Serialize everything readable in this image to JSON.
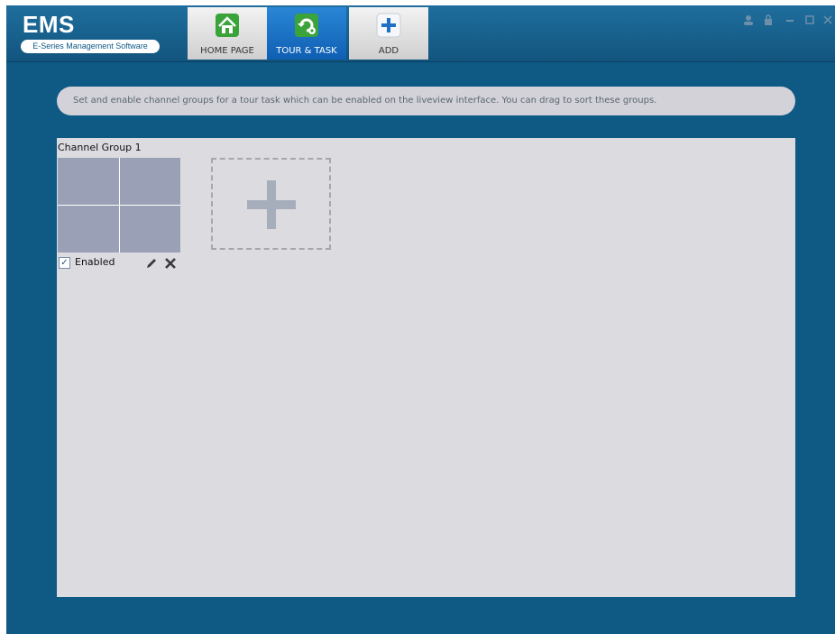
{
  "app": {
    "title": "EMS",
    "subtitle": "E-Series Management Software"
  },
  "tabs": [
    {
      "label": "HOME PAGE",
      "icon": "home-icon",
      "active": false
    },
    {
      "label": "TOUR & TASK",
      "icon": "tour-task-icon",
      "active": true
    },
    {
      "label": "ADD",
      "icon": "add-icon",
      "active": false
    }
  ],
  "window_controls": [
    "user-icon",
    "lock-icon",
    "minimize-icon",
    "maximize-icon",
    "close-icon"
  ],
  "banner": {
    "text": "Set and enable channel groups for a tour task which can be enabled on the liveview interface. You can drag to sort these groups."
  },
  "groups": [
    {
      "title": "Channel Group 1",
      "enabled": true,
      "enabled_label": "Enabled",
      "layout": "2x2"
    }
  ],
  "colors": {
    "window_bg": "#0f5a85",
    "tab_active": "#1a73c8",
    "panel_bg": "#dcdce0",
    "cell": "#9aa1b6"
  }
}
